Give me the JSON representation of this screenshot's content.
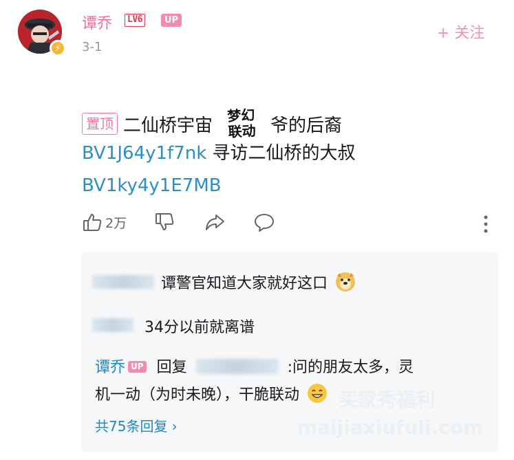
{
  "header": {
    "username": "谭乔",
    "level": "LV6",
    "up_badge": "UP",
    "date": "3-1",
    "follow_label": "+ 关注"
  },
  "content": {
    "pin_label": "置顶",
    "line1_before": "二仙桥宇宙",
    "sticker_top": "梦幻",
    "sticker_bottom": "联动",
    "line1_after": "爷的后裔",
    "line2_link": "BV1J64y1f7nk",
    "line2_text": " 寻访二仙桥的大叔",
    "line3_link": "BV1ky4y1E7MB"
  },
  "actions": {
    "like_count": "2万"
  },
  "replies": {
    "items": [
      {
        "text": "谭警官知道大家就好这口"
      },
      {
        "text": "34分以前就离谱"
      }
    ],
    "up_reply": {
      "name": "谭乔",
      "badge": "UP",
      "reply_word": "回复",
      "text_line1": ":问的朋友太多，灵",
      "text_line2": "机一动（为时未晚），干脆联动"
    },
    "total_label": "共75条回复 ›"
  },
  "watermark": {
    "line1": "买家秀福利",
    "line2": "maijiaxiufuli.com"
  },
  "colors": {
    "pink": "#f16f9a",
    "link_blue": "#2a8fc7",
    "reply_bg": "#f6f7f8"
  }
}
